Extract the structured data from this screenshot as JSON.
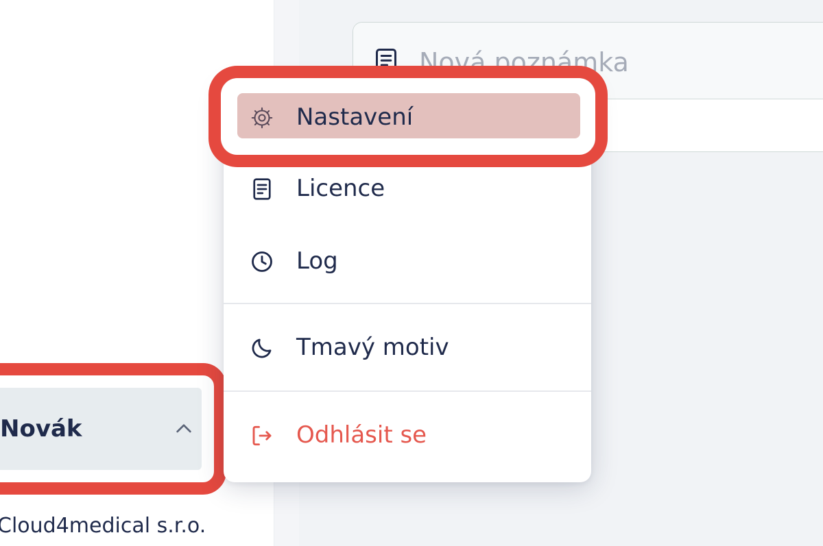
{
  "note": {
    "placeholder": "Nová poznámka",
    "icon": "document-icon"
  },
  "user": {
    "name": "Novák",
    "company": "Cloud4medical s.r.o.",
    "chevron_icon": "chevron-up-icon"
  },
  "menu": {
    "items": [
      {
        "id": "settings",
        "label": "Nastavení",
        "icon": "gear-icon",
        "highlighted": true
      },
      {
        "id": "license",
        "label": "Licence",
        "icon": "document-icon"
      },
      {
        "id": "log",
        "label": "Log",
        "icon": "clock-icon"
      },
      {
        "id": "theme",
        "label": "Tmavý motiv",
        "icon": "moon-icon"
      },
      {
        "id": "logout",
        "label": "Odhlásit se",
        "icon": "logout-icon"
      }
    ]
  },
  "colors": {
    "accent_red": "#e5493f",
    "highlight_fill": "#e3c0bd",
    "text_primary": "#1f2a4b",
    "logout_red": "#e5584e",
    "placeholder": "#a6acb8"
  }
}
